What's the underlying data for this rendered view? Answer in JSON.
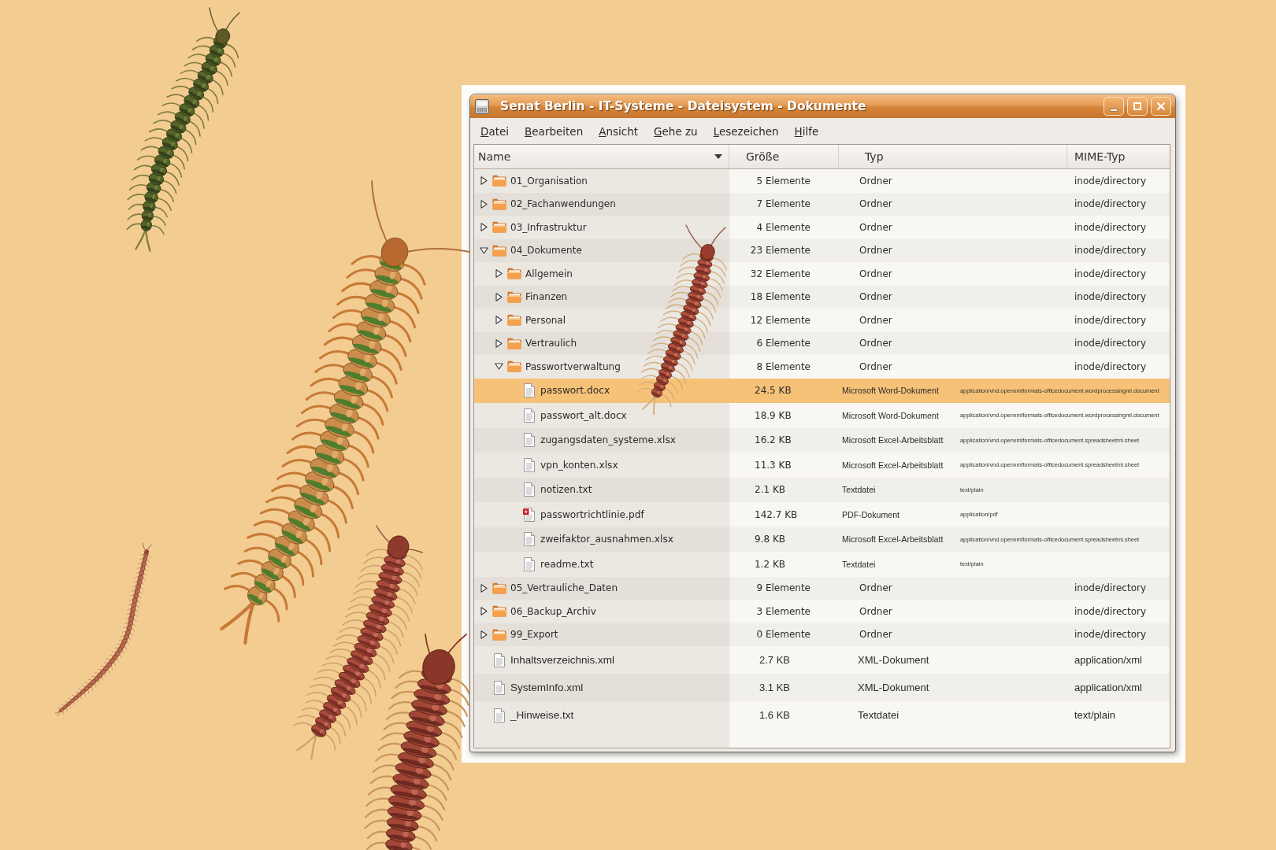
{
  "window": {
    "title": "Senat Berlin - IT-Systeme - Dateisystem - Dokumente"
  },
  "menu": [
    {
      "label": "Datei"
    },
    {
      "label": "Bearbeiten"
    },
    {
      "label": "Ansicht"
    },
    {
      "label": "Gehe zu"
    },
    {
      "label": "Lesezeichen"
    },
    {
      "label": "Hilfe"
    }
  ],
  "columns": [
    {
      "label": "Name",
      "sorted": true
    },
    {
      "label": "Größe",
      "sorted": false
    },
    {
      "label": "Typ",
      "sorted": false
    },
    {
      "label": "MIME-Typ",
      "sorted": false
    }
  ],
  "tree": [
    {
      "kind": "folder",
      "name": "01_Organisation",
      "size": "5 Elemente",
      "type": "Ordner",
      "mime": "inode/directory",
      "expanded": false,
      "selected": false
    },
    {
      "kind": "folder",
      "name": "02_Fachanwendungen",
      "size": "7 Elemente",
      "type": "Ordner",
      "mime": "inode/directory",
      "expanded": false,
      "selected": false
    },
    {
      "kind": "folder",
      "name": "03_Infrastruktur",
      "size": "4 Elemente",
      "type": "Ordner",
      "mime": "inode/directory",
      "expanded": false,
      "selected": false
    },
    {
      "kind": "folder",
      "name": "04_Dokumente",
      "size": "23 Elemente",
      "type": "Ordner",
      "mime": "inode/directory",
      "expanded": true,
      "selected": false,
      "children": [
        {
          "kind": "folder",
          "name": "Allgemein",
          "size": "32 Elemente",
          "type": "Ordner",
          "mime": "inode/directory",
          "expanded": false,
          "selected": false
        },
        {
          "kind": "folder",
          "name": "Finanzen",
          "size": "18 Elemente",
          "type": "Ordner",
          "mime": "inode/directory",
          "expanded": false,
          "selected": false
        },
        {
          "kind": "folder",
          "name": "Personal",
          "size": "12 Elemente",
          "type": "Ordner",
          "mime": "inode/directory",
          "expanded": false,
          "selected": false
        },
        {
          "kind": "folder",
          "name": "Vertraulich",
          "size": "6 Elemente",
          "type": "Ordner",
          "mime": "inode/directory",
          "expanded": false,
          "selected": false
        },
        {
          "kind": "folder",
          "name": "Passwortverwaltung",
          "size": "8 Elemente",
          "type": "Ordner",
          "mime": "inode/directory",
          "expanded": true,
          "selected": false,
          "children": [
            {
              "kind": "document",
              "name": "passwort.docx",
              "size": "24.5 KB",
              "type": "Microsoft Word-Dokument",
              "mime": "application/vnd.openxmlformats-officedocument.wordprocessingml.document",
              "selected": true
            },
            {
              "kind": "document",
              "name": "passwort_alt.docx",
              "size": "18.9 KB",
              "type": "Microsoft Word-Dokument",
              "mime": "application/vnd.openxmlformats-officedocument.wordprocessingml.document",
              "selected": false
            },
            {
              "kind": "document",
              "name": "zugangsdaten_systeme.xlsx",
              "size": "16.2 KB",
              "type": "Microsoft Excel-Arbeitsblatt",
              "mime": "application/vnd.openxmlformats-officedocument.spreadsheetml.sheet",
              "selected": false
            },
            {
              "kind": "document",
              "name": "vpn_konten.xlsx",
              "size": "11.3 KB",
              "type": "Microsoft Excel-Arbeitsblatt",
              "mime": "application/vnd.openxmlformats-officedocument.spreadsheetml.sheet",
              "selected": false
            },
            {
              "kind": "document",
              "name": "notizen.txt",
              "size": "2.1 KB",
              "type": "Textdatei",
              "mime": "text/plain",
              "selected": false
            },
            {
              "kind": "pdf",
              "name": "passwortrichtlinie.pdf",
              "size": "142.7 KB",
              "type": "PDF-Dokument",
              "mime": "application/pdf",
              "selected": false
            },
            {
              "kind": "document",
              "name": "zweifaktor_ausnahmen.xlsx",
              "size": "9.8 KB",
              "type": "Microsoft Excel-Arbeitsblatt",
              "mime": "application/vnd.openxmlformats-officedocument.spreadsheetml.sheet",
              "selected": false
            },
            {
              "kind": "document",
              "name": "readme.txt",
              "size": "1.2 KB",
              "type": "Textdatei",
              "mime": "text/plain",
              "selected": false
            }
          ]
        }
      ]
    },
    {
      "kind": "folder",
      "name": "05_Vertrauliche_Daten",
      "size": "9 Elemente",
      "type": "Ordner",
      "mime": "inode/directory",
      "expanded": false,
      "selected": false
    },
    {
      "kind": "folder",
      "name": "06_Backup_Archiv",
      "size": "3 Elemente",
      "type": "Ordner",
      "mime": "inode/directory",
      "expanded": false,
      "selected": false
    },
    {
      "kind": "folder",
      "name": "99_Export",
      "size": "0 Elemente",
      "type": "Ordner",
      "mime": "inode/directory",
      "expanded": false,
      "selected": false
    },
    {
      "kind": "document",
      "name": "Inhaltsverzeichnis.xml",
      "size": "2.7 KB",
      "type": "XML-Dokument",
      "mime": "application/xml",
      "selected": false
    },
    {
      "kind": "document",
      "name": "SystemInfo.xml",
      "size": "3.1 KB",
      "type": "XML-Dokument",
      "mime": "application/xml",
      "selected": false
    },
    {
      "kind": "document",
      "name": "_Hinweise.txt",
      "size": "1.6 KB",
      "type": "Textdatei",
      "mime": "text/plain",
      "selected": false
    }
  ]
}
